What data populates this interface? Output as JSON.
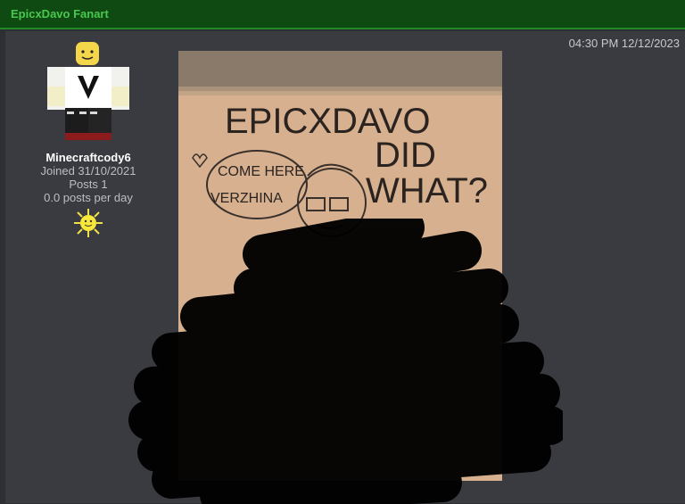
{
  "header": {
    "title": "EpicxDavo Fanart"
  },
  "post": {
    "timestamp": "04:30 PM 12/12/2023",
    "user": {
      "name": "Minecraftcody6",
      "joined": "Joined 31/10/2021",
      "posts": "Posts 1",
      "rate": "0.0 posts per day",
      "badge_icon": "sun-badge-icon",
      "avatar_icon": "roblox-avatar-icon"
    },
    "image": {
      "handwritten_text": [
        "EPICXDAVO",
        "DID",
        "WHAT?"
      ],
      "speech_bubble": [
        "COME HERE",
        "VERZHINA"
      ]
    }
  }
}
